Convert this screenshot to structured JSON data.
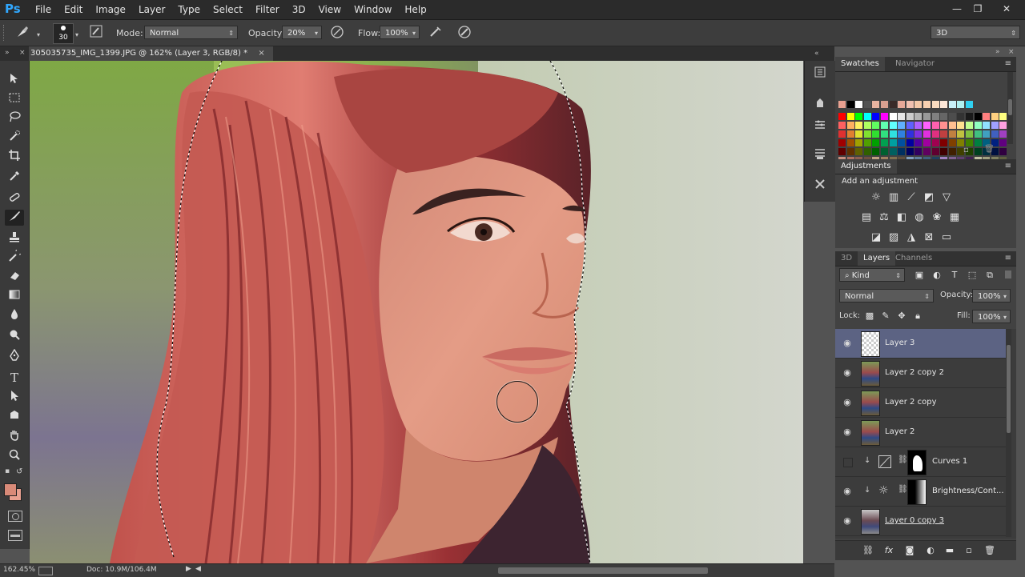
{
  "app": {
    "logo": "Ps"
  },
  "menu": [
    "File",
    "Edit",
    "Image",
    "Layer",
    "Type",
    "Select",
    "Filter",
    "3D",
    "View",
    "Window",
    "Help"
  ],
  "window_controls": {
    "minimize": "—",
    "restore": "❐",
    "close": "✕"
  },
  "options": {
    "brush_size": "30",
    "mode_label": "Mode:",
    "mode_value": "Normal",
    "opacity_label": "Opacity:",
    "opacity_value": "20%",
    "flow_label": "Flow:",
    "flow_value": "100%",
    "workspace": "3D"
  },
  "document": {
    "tab_title": "305035735_IMG_1399.JPG @ 162% (Layer 3, RGB/8) *",
    "close": "×"
  },
  "status": {
    "zoom": "162.45%",
    "doc": "Doc: 10.9M/106.4M"
  },
  "tools": [
    "move-tool",
    "marquee-tool",
    "lasso-tool",
    "quick-selection-tool",
    "crop-tool",
    "eyedropper-tool",
    "spot-healing-tool",
    "brush-tool",
    "clone-stamp-tool",
    "history-brush-tool",
    "eraser-tool",
    "gradient-tool",
    "blur-tool",
    "dodge-tool",
    "pen-tool",
    "type-tool",
    "path-selection-tool",
    "shape-tool",
    "hand-tool",
    "zoom-tool"
  ],
  "colors": {
    "foreground": "#d98a78",
    "background": "#e8a090",
    "selection_accent": "#5c6383"
  },
  "panels": {
    "swatches_tab": "Swatches",
    "navigator_tab": "Navigator",
    "adjustments_tab": "Adjustments",
    "adjustments_hint": "Add an adjustment",
    "layers_tabs": [
      "3D",
      "Layers",
      "Channels"
    ],
    "kind_filter": "Kind",
    "blend_mode": "Normal",
    "opacity_label": "Opacity:",
    "opacity_value": "100%",
    "lock_label": "Lock:",
    "fill_label": "Fill:",
    "fill_value": "100%"
  },
  "layers": [
    {
      "name": "Layer 3",
      "selected": true,
      "type": "transparent"
    },
    {
      "name": "Layer 2 copy 2",
      "selected": false,
      "type": "photo"
    },
    {
      "name": "Layer 2 copy",
      "selected": false,
      "type": "photo"
    },
    {
      "name": "Layer 2",
      "selected": false,
      "type": "photo"
    },
    {
      "name": "Curves 1",
      "selected": false,
      "type": "adjustment",
      "hidden": true
    },
    {
      "name": "Brightness/Cont...",
      "selected": false,
      "type": "adjustment"
    },
    {
      "name": "Layer 0 copy 3",
      "selected": false,
      "type": "photo"
    }
  ]
}
